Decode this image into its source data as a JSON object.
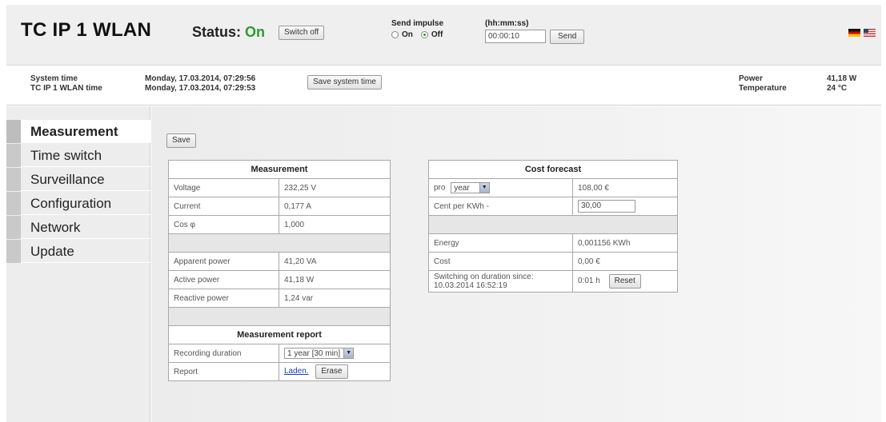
{
  "header": {
    "title": "TC IP 1 WLAN",
    "status_label": "Status:",
    "status_value": "On",
    "status_color": "#2e9a2e",
    "switch_off_label": "Switch off",
    "impulse_label": "Send impulse",
    "impulse_options": {
      "on": "On",
      "off": "Off"
    },
    "impulse_selected": "off",
    "time_format_label": "(hh:mm:ss)",
    "impulse_time_value": "00:00:10",
    "send_label": "Send",
    "languages": [
      "de-flag-icon",
      "us-flag-icon"
    ]
  },
  "info": {
    "system_time_label": "System time",
    "device_time_label": "TC IP 1 WLAN time",
    "system_time_value": "Monday, 17.03.2014, 07:29:56",
    "device_time_value": "Monday, 17.03.2014, 07:29:53",
    "save_system_time_label": "Save system time",
    "power_label": "Power",
    "temperature_label": "Temperature",
    "power_value": "41,18 W",
    "temperature_value": "24 °C"
  },
  "sidebar": {
    "items": [
      {
        "label": "Measurement",
        "active": true
      },
      {
        "label": "Time switch"
      },
      {
        "label": "Surveillance"
      },
      {
        "label": "Configuration"
      },
      {
        "label": "Network"
      },
      {
        "label": "Update"
      }
    ]
  },
  "main": {
    "save_label": "Save",
    "measurement": {
      "heading": "Measurement",
      "rows": [
        {
          "label": "Voltage",
          "value": "232,25 V"
        },
        {
          "label": "Current",
          "value": "0,177 A"
        },
        {
          "label": "Cos φ",
          "value": "1,000"
        },
        {
          "label": "Apparent power",
          "value": "41,20 VA"
        },
        {
          "label": "Active power",
          "value": "41,18 W"
        },
        {
          "label": "Reactive power",
          "value": "1,24 var"
        }
      ]
    },
    "report": {
      "heading": "Measurement report",
      "duration_label": "Recording duration",
      "duration_value": "1 year [30 min]",
      "report_label": "Report",
      "load_link": "Laden.",
      "erase_label": "Erase"
    },
    "cost": {
      "heading": "Cost forecast",
      "period_label": "pro",
      "period_value": "year",
      "period_cost": "108,00 €",
      "cent_label": "Cent per KWh -",
      "cent_value": "30,00",
      "energy_label": "Energy",
      "energy_value": "0,001156 KWh",
      "cost_label": "Cost",
      "cost_value": "0,00 €",
      "duration_label_line1": "Switching on duration since:",
      "duration_label_line2": "10.03.2014 16:52:19",
      "duration_value": "0:01 h",
      "reset_label": "Reset"
    }
  }
}
